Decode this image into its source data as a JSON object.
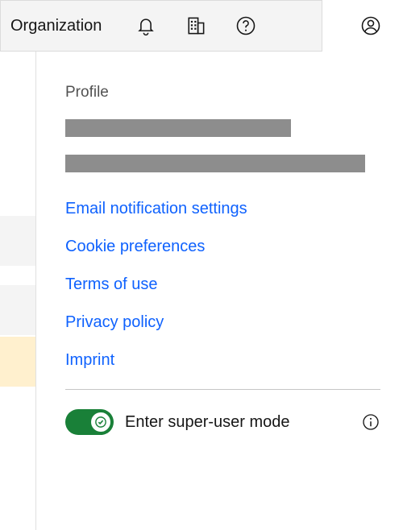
{
  "header": {
    "organization_label": "Organization"
  },
  "profile_menu": {
    "heading": "Profile",
    "links": [
      "Email notification settings",
      "Cookie preferences",
      "Terms of use",
      "Privacy policy",
      "Imprint"
    ],
    "super_user": {
      "label": "Enter super-user mode",
      "enabled": true
    }
  }
}
